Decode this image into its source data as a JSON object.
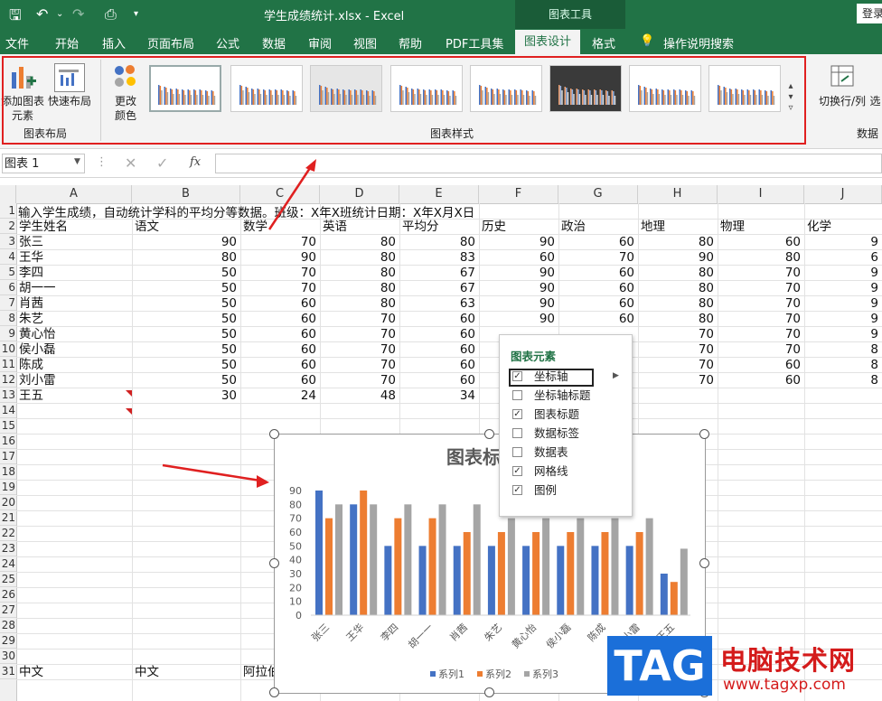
{
  "window": {
    "doc_title": "学生成绩统计.xlsx  -  Excel",
    "context_tool": "图表工具",
    "login": "登录"
  },
  "tabs": [
    "文件",
    "开始",
    "插入",
    "页面布局",
    "公式",
    "数据",
    "审阅",
    "视图",
    "帮助",
    "PDF工具集",
    "图表设计",
    "格式"
  ],
  "active_tab": "图表设计",
  "tell_me": "操作说明搜索",
  "ribbon": {
    "add_element": "添加图表\n元素",
    "quick_layout": "快速布局",
    "change_colors": "更改\n颜色",
    "group_layout": "图表布局",
    "group_styles": "图表样式",
    "switch_row_col": "切换行/列",
    "select_data": "选",
    "group_data": "数据"
  },
  "formula_bar": {
    "name_box": "图表 1",
    "fx": "fx",
    "value": ""
  },
  "columns": [
    "A",
    "B",
    "C",
    "D",
    "E",
    "F",
    "G",
    "H",
    "I",
    "J"
  ],
  "rows": [
    "1",
    "2",
    "3",
    "4",
    "5",
    "6",
    "7",
    "8",
    "9",
    "10",
    "11",
    "12",
    "13",
    "14",
    "15",
    "16",
    "17",
    "18",
    "19",
    "20",
    "21",
    "22",
    "23",
    "24",
    "25",
    "26",
    "27",
    "28",
    "29",
    "30",
    "31"
  ],
  "sheet": {
    "row1": "输入学生成绩，自动统计学科的平均分等数据。班级：X年X班统计日期：X年X月X日",
    "headers": [
      "学生姓名",
      "语文",
      "数学",
      "英语",
      "平均分",
      "历史",
      "政治",
      "地理",
      "物理",
      "化学"
    ],
    "data": [
      [
        "张三",
        "90",
        "70",
        "80",
        "80",
        "90",
        "60",
        "80",
        "60",
        "9"
      ],
      [
        "王华",
        "80",
        "90",
        "80",
        "83",
        "60",
        "70",
        "90",
        "80",
        "6"
      ],
      [
        "李四",
        "50",
        "70",
        "80",
        "67",
        "90",
        "60",
        "80",
        "70",
        "9"
      ],
      [
        "胡一一",
        "50",
        "70",
        "80",
        "67",
        "90",
        "60",
        "80",
        "70",
        "9"
      ],
      [
        "肖茜",
        "50",
        "60",
        "80",
        "63",
        "90",
        "60",
        "80",
        "70",
        "9"
      ],
      [
        "朱艺",
        "50",
        "60",
        "70",
        "60",
        "90",
        "60",
        "80",
        "70",
        "9"
      ],
      [
        "黄心怡",
        "50",
        "60",
        "70",
        "60",
        "",
        "",
        "70",
        "70",
        "9"
      ],
      [
        "侯小磊",
        "50",
        "60",
        "70",
        "60",
        "",
        "",
        "70",
        "70",
        "8"
      ],
      [
        "陈成",
        "50",
        "60",
        "70",
        "60",
        "",
        "",
        "70",
        "60",
        "8"
      ],
      [
        "刘小雷",
        "50",
        "60",
        "70",
        "60",
        "",
        "",
        "70",
        "60",
        "8"
      ],
      [
        "王五",
        "30",
        "24",
        "48",
        "34",
        "",
        "",
        "",
        "",
        ""
      ]
    ],
    "row31": [
      "中文",
      "中文",
      "阿拉伯数字"
    ]
  },
  "chart_data": {
    "type": "bar",
    "title": "图表标",
    "categories": [
      "张三",
      "王华",
      "李四",
      "胡一一",
      "肖茜",
      "朱艺",
      "黄心怡",
      "侯小磊",
      "陈成",
      "刘小雷",
      "王五"
    ],
    "series": [
      {
        "name": "系列1",
        "values": [
          90,
          80,
          50,
          50,
          50,
          50,
          50,
          50,
          50,
          50,
          30
        ]
      },
      {
        "name": "系列2",
        "values": [
          70,
          90,
          70,
          70,
          60,
          60,
          60,
          60,
          60,
          60,
          24
        ]
      },
      {
        "name": "系列3",
        "values": [
          80,
          80,
          80,
          80,
          80,
          70,
          70,
          70,
          70,
          70,
          48
        ]
      }
    ],
    "y_ticks": [
      "0",
      "10",
      "20",
      "30",
      "40",
      "50",
      "60",
      "70",
      "80",
      "90"
    ],
    "ylim": [
      0,
      90
    ],
    "legend": "bottom",
    "grid": false,
    "colors": [
      "#4472c4",
      "#ed7d31",
      "#a5a5a5"
    ]
  },
  "chart_elements_popup": {
    "title": "图表元素",
    "items": [
      {
        "label": "坐标轴",
        "checked": true
      },
      {
        "label": "坐标轴标题",
        "checked": false
      },
      {
        "label": "图表标题",
        "checked": true
      },
      {
        "label": "数据标签",
        "checked": false
      },
      {
        "label": "数据表",
        "checked": false
      },
      {
        "label": "网格线",
        "checked": true
      },
      {
        "label": "图例",
        "checked": true
      }
    ]
  },
  "watermark": {
    "tag": "TAG",
    "name": "电脑技术网",
    "url": "www.tagxp.com"
  },
  "colors": {
    "excel_green": "#217346",
    "highlight": "#e02020"
  }
}
